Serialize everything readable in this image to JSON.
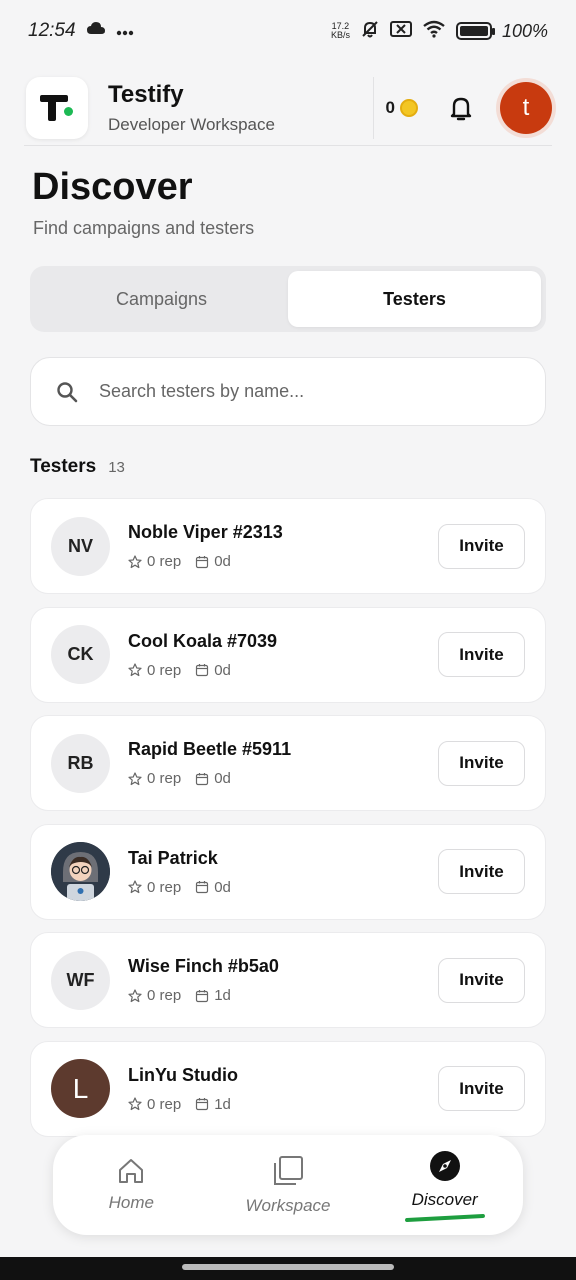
{
  "status_bar": {
    "time": "12:54",
    "icons_left": [
      "cloud-icon",
      "more-icon"
    ],
    "net_speed_value": "17.2",
    "net_speed_unit": "KB/s",
    "battery": "100%",
    "icons_right": [
      "mute-bell-icon",
      "sim-off-icon",
      "wifi-icon",
      "battery-icon"
    ]
  },
  "header": {
    "app_name": "Testify",
    "workspace": "Developer Workspace",
    "coins": "0",
    "user_initial": "t",
    "colors": {
      "avatar": "#c83a0f",
      "logo_dot": "#1db954",
      "coin": "#f3c623"
    }
  },
  "page": {
    "title": "Discover",
    "subtitle": "Find campaigns and testers"
  },
  "tabs": [
    {
      "label": "Campaigns",
      "active": false
    },
    {
      "label": "Testers",
      "active": true
    }
  ],
  "search": {
    "placeholder": "Search testers by name...",
    "value": ""
  },
  "testers_section": {
    "title": "Testers",
    "count": "13",
    "invite_label": "Invite",
    "items": [
      {
        "initials": "NV",
        "name": "Noble Viper #2313",
        "rep": "0 rep",
        "days": "0d",
        "avatar": "initials"
      },
      {
        "initials": "CK",
        "name": "Cool Koala #7039",
        "rep": "0 rep",
        "days": "0d",
        "avatar": "initials"
      },
      {
        "initials": "RB",
        "name": "Rapid Beetle #5911",
        "rep": "0 rep",
        "days": "0d",
        "avatar": "initials"
      },
      {
        "initials": "",
        "name": "Tai Patrick",
        "rep": "0 rep",
        "days": "0d",
        "avatar": "photo"
      },
      {
        "initials": "WF",
        "name": "Wise Finch #b5a0",
        "rep": "0 rep",
        "days": "1d",
        "avatar": "initials"
      },
      {
        "initials": "L",
        "name": "LinYu Studio",
        "rep": "0 rep",
        "days": "1d",
        "avatar": "letter-brown"
      }
    ]
  },
  "bottom_nav": {
    "items": [
      {
        "label": "Home",
        "icon": "home-icon",
        "active": false
      },
      {
        "label": "Workspace",
        "icon": "workspace-icon",
        "active": false
      },
      {
        "label": "Discover",
        "icon": "compass-icon",
        "active": true
      }
    ],
    "active_color": "#1e9e3f"
  }
}
